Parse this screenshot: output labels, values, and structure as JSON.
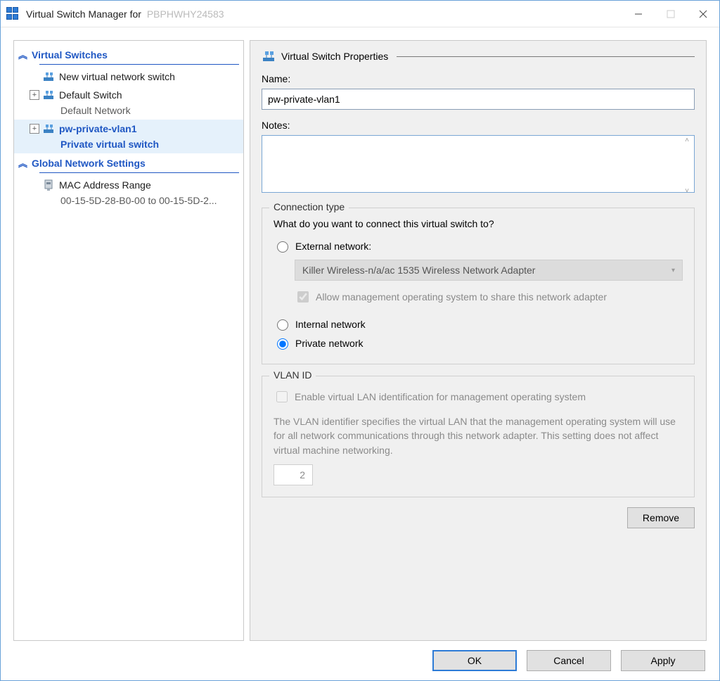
{
  "window": {
    "title_prefix": "Virtual Switch Manager for",
    "host": "PBPHWHY24583"
  },
  "sidebar": {
    "sections": {
      "virtual_switches": "Virtual Switches",
      "global_settings": "Global Network Settings"
    },
    "new_switch": "New virtual network switch",
    "default_switch": {
      "name": "Default Switch",
      "sub": "Default Network"
    },
    "selected_switch": {
      "name": "pw-private-vlan1",
      "sub": "Private virtual switch"
    },
    "mac_range": {
      "name": "MAC Address Range",
      "sub": "00-15-5D-28-B0-00 to 00-15-5D-2..."
    }
  },
  "properties": {
    "header": "Virtual Switch Properties",
    "name_label": "Name:",
    "name_value": "pw-private-vlan1",
    "notes_label": "Notes:",
    "notes_value": ""
  },
  "connection": {
    "legend": "Connection type",
    "prompt": "What do you want to connect this virtual switch to?",
    "external_label": "External network:",
    "adapter": "Killer Wireless-n/a/ac 1535 Wireless Network Adapter",
    "allow_mgmt": "Allow management operating system to share this network adapter",
    "internal_label": "Internal network",
    "private_label": "Private network",
    "selected": "private"
  },
  "vlan": {
    "legend": "VLAN ID",
    "enable_label": "Enable virtual LAN identification for management operating system",
    "description": "The VLAN identifier specifies the virtual LAN that the management operating system will use for all network communications through this network adapter. This setting does not affect virtual machine networking.",
    "value": "2"
  },
  "buttons": {
    "remove": "Remove",
    "ok": "OK",
    "cancel": "Cancel",
    "apply": "Apply"
  }
}
